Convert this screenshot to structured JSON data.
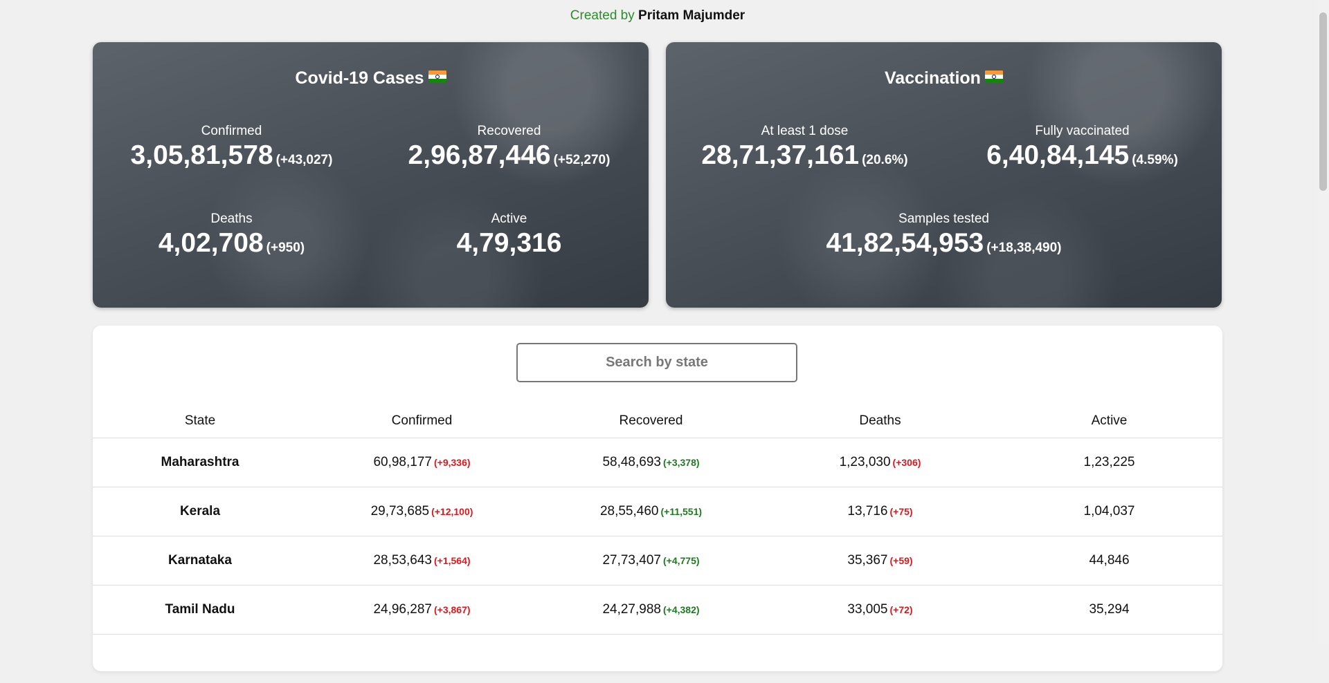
{
  "credit": {
    "prefix": "Created by",
    "author": "Pritam Majumder"
  },
  "cases": {
    "title": "Covid-19 Cases",
    "confirmed": {
      "label": "Confirmed",
      "value": "3,05,81,578",
      "delta": "(+43,027)"
    },
    "recovered": {
      "label": "Recovered",
      "value": "2,96,87,446",
      "delta": "(+52,270)"
    },
    "deaths": {
      "label": "Deaths",
      "value": "4,02,708",
      "delta": "(+950)"
    },
    "active": {
      "label": "Active",
      "value": "4,79,316"
    }
  },
  "vaccination": {
    "title": "Vaccination",
    "one_dose": {
      "label": "At least 1 dose",
      "value": "28,71,37,161",
      "delta": "(20.6%)"
    },
    "fully": {
      "label": "Fully vaccinated",
      "value": "6,40,84,145",
      "delta": "(4.59%)"
    },
    "samples": {
      "label": "Samples tested",
      "value": "41,82,54,953",
      "delta": "(+18,38,490)"
    }
  },
  "search": {
    "placeholder": "Search by state"
  },
  "table": {
    "headers": [
      "State",
      "Confirmed",
      "Recovered",
      "Deaths",
      "Active"
    ],
    "rows": [
      {
        "state": "Maharashtra",
        "confirmed": "60,98,177",
        "confirmed_delta": "(+9,336)",
        "recovered": "58,48,693",
        "recovered_delta": "(+3,378)",
        "deaths": "1,23,030",
        "deaths_delta": "(+306)",
        "active": "1,23,225"
      },
      {
        "state": "Kerala",
        "confirmed": "29,73,685",
        "confirmed_delta": "(+12,100)",
        "recovered": "28,55,460",
        "recovered_delta": "(+11,551)",
        "deaths": "13,716",
        "deaths_delta": "(+75)",
        "active": "1,04,037"
      },
      {
        "state": "Karnataka",
        "confirmed": "28,53,643",
        "confirmed_delta": "(+1,564)",
        "recovered": "27,73,407",
        "recovered_delta": "(+4,775)",
        "deaths": "35,367",
        "deaths_delta": "(+59)",
        "active": "44,846"
      },
      {
        "state": "Tamil Nadu",
        "confirmed": "24,96,287",
        "confirmed_delta": "(+3,867)",
        "recovered": "24,27,988",
        "recovered_delta": "(+4,382)",
        "deaths": "33,005",
        "deaths_delta": "(+72)",
        "active": "35,294"
      }
    ]
  },
  "colors": {
    "increase": "#e0161b",
    "recovered": "#1e7a1e",
    "credit": "#2e8b2e"
  }
}
